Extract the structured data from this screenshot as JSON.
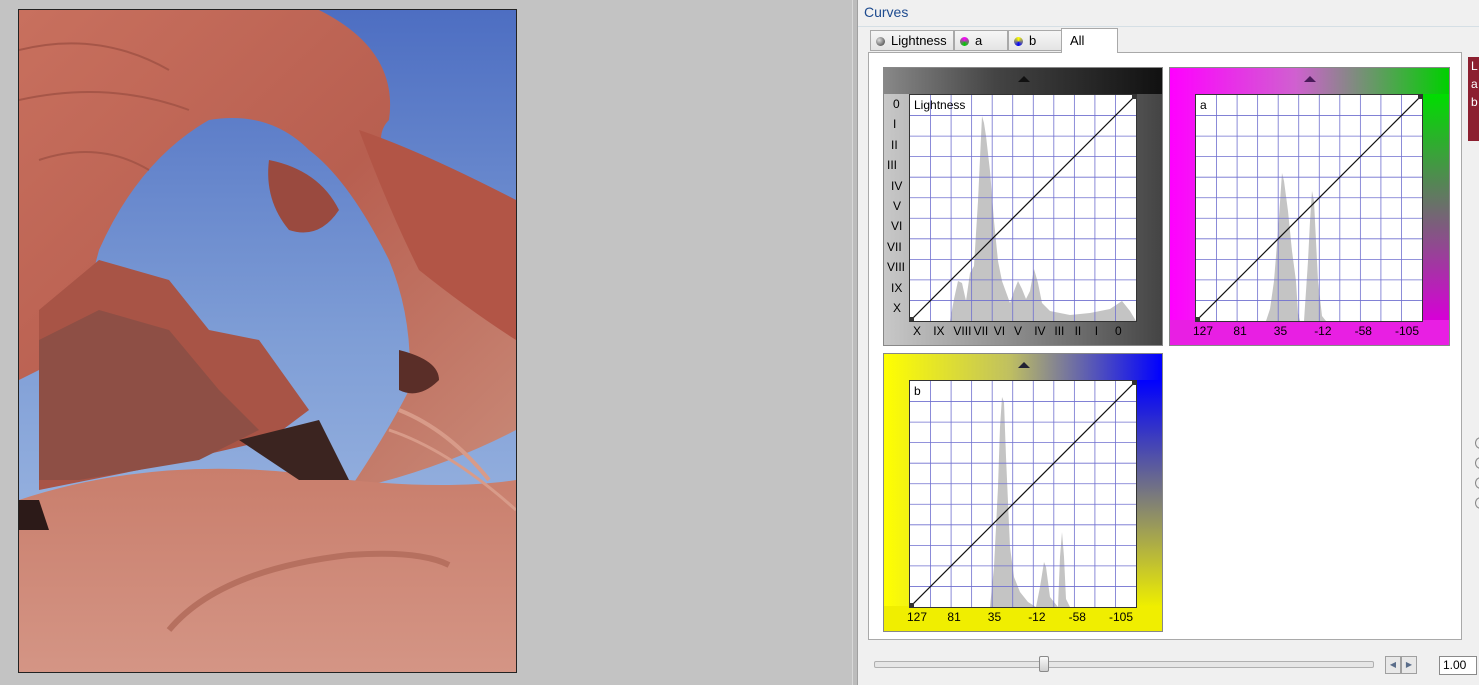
{
  "panel": {
    "title": "Curves",
    "tabs": [
      {
        "label": "Lightness",
        "dot_color": "#444444"
      },
      {
        "label": "a",
        "dot_color": "#7a3fa0"
      },
      {
        "label": "b",
        "dot_color": "#3a8a3a"
      },
      {
        "label": "All"
      }
    ],
    "active_tab": "All",
    "side_tab_lines": [
      "L",
      "a",
      "b"
    ]
  },
  "curves": {
    "lightness": {
      "label": "Lightness",
      "x_ticks": [
        "X",
        "IX",
        "VIII",
        "VII",
        "VI",
        "V",
        "IV",
        "III",
        "II",
        "I",
        "0"
      ],
      "y_ticks": [
        "0",
        "I",
        "II",
        "III",
        "IV",
        "V",
        "VI",
        "VII",
        "VIII",
        "IX",
        "X"
      ]
    },
    "a": {
      "label": "a",
      "x_ticks": [
        "127",
        "81",
        "35",
        "-12",
        "-58",
        "-105"
      ]
    },
    "b": {
      "label": "b",
      "x_ticks": [
        "127",
        "81",
        "35",
        "-12",
        "-58",
        "-105"
      ]
    }
  },
  "gamma": {
    "value": "1.00",
    "slider_fraction": 0.34
  },
  "colors": {
    "title": "#1e4b8f",
    "grid": "#6f6fcf",
    "histogram": "#c4c4c4",
    "a_left": "#ff00ff",
    "a_right": "#00dd00",
    "b_left": "#ffff00",
    "b_right": "#0000ff"
  }
}
